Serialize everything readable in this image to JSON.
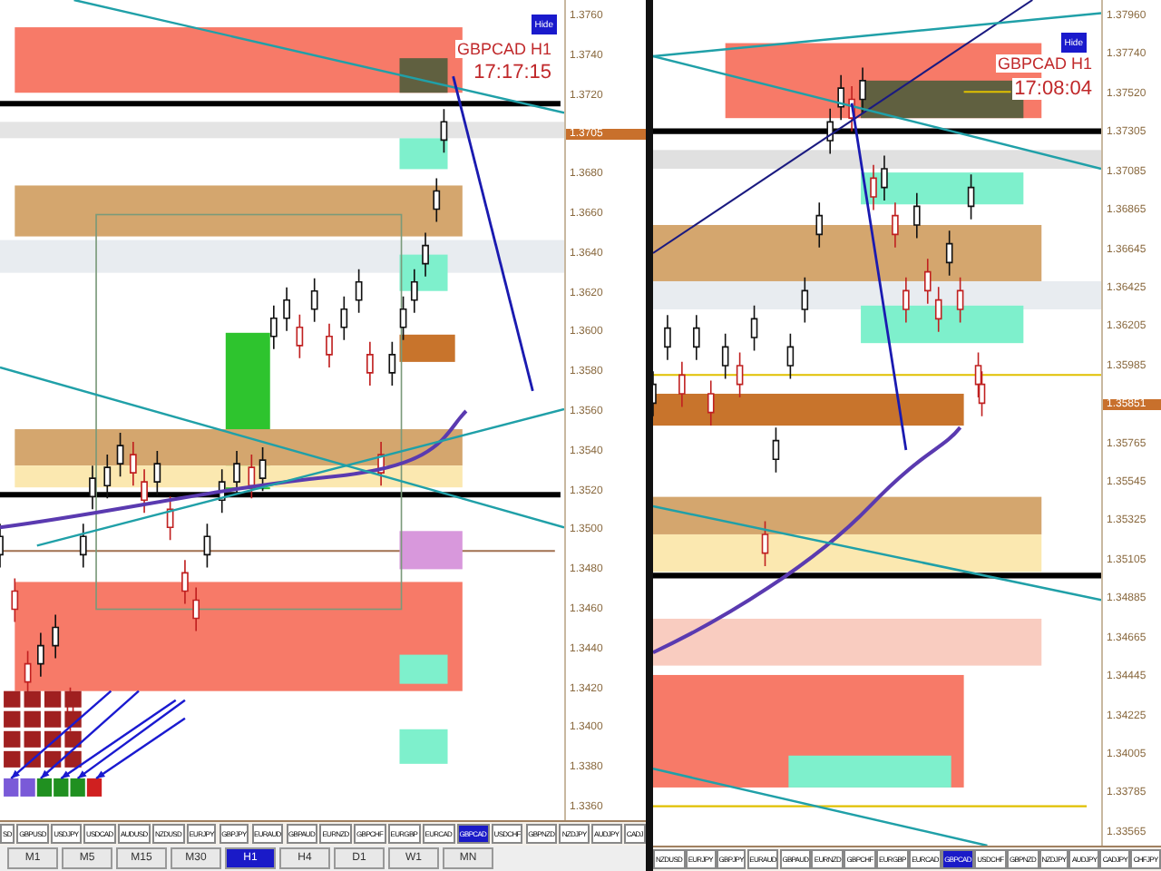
{
  "left_chart": {
    "title": "GBPCAD H1",
    "clock": "17:17:15",
    "hide_button": "Hide",
    "price_axis": [
      {
        "label": "1.3760",
        "current": false
      },
      {
        "label": "1.3740",
        "current": false
      },
      {
        "label": "1.3720",
        "current": false
      },
      {
        "label": "1.3705",
        "current": true
      },
      {
        "label": "1.3680",
        "current": false
      },
      {
        "label": "1.3660",
        "current": false
      },
      {
        "label": "1.3640",
        "current": false
      },
      {
        "label": "1.3620",
        "current": false
      },
      {
        "label": "1.3600",
        "current": false
      },
      {
        "label": "1.3580",
        "current": false
      },
      {
        "label": "1.3560",
        "current": false
      },
      {
        "label": "1.3540",
        "current": false
      },
      {
        "label": "1.3520",
        "current": false
      },
      {
        "label": "1.3500",
        "current": false
      },
      {
        "label": "1.3480",
        "current": false
      },
      {
        "label": "1.3460",
        "current": false
      },
      {
        "label": "1.3440",
        "current": false
      },
      {
        "label": "1.3420",
        "current": false
      },
      {
        "label": "1.3400",
        "current": false
      },
      {
        "label": "1.3380",
        "current": false
      },
      {
        "label": "1.3360",
        "current": false
      }
    ],
    "symbols": [
      {
        "label": "SD",
        "selected": false
      },
      {
        "label": "GBPUSD",
        "selected": false
      },
      {
        "label": "USDJPY",
        "selected": false
      },
      {
        "label": "USDCAD",
        "selected": false
      },
      {
        "label": "AUDUSD",
        "selected": false
      },
      {
        "label": "NZDUSD",
        "selected": false
      },
      {
        "label": "EURJPY",
        "selected": false
      },
      {
        "label": "GBPJPY",
        "selected": false
      },
      {
        "label": "EURAUD",
        "selected": false
      },
      {
        "label": "GBPAUD",
        "selected": false
      },
      {
        "label": "EURNZD",
        "selected": false
      },
      {
        "label": "GBPCHF",
        "selected": false
      },
      {
        "label": "EURGBP",
        "selected": false
      },
      {
        "label": "EURCAD",
        "selected": false
      },
      {
        "label": "GBPCAD",
        "selected": true
      },
      {
        "label": "USDCHF",
        "selected": false
      },
      {
        "label": "GBPNZD",
        "selected": false
      },
      {
        "label": "NZDJPY",
        "selected": false
      },
      {
        "label": "AUDJPY",
        "selected": false
      },
      {
        "label": "CADJ",
        "selected": false
      }
    ],
    "timeframes": [
      {
        "label": "M1",
        "selected": false
      },
      {
        "label": "M5",
        "selected": false
      },
      {
        "label": "M15",
        "selected": false
      },
      {
        "label": "M30",
        "selected": false
      },
      {
        "label": "H1",
        "selected": true
      },
      {
        "label": "H4",
        "selected": false
      },
      {
        "label": "D1",
        "selected": false
      },
      {
        "label": "W1",
        "selected": false
      },
      {
        "label": "MN",
        "selected": false
      }
    ]
  },
  "right_chart": {
    "title": "GBPCAD H1",
    "clock": "17:08:04",
    "hide_button": "Hide",
    "price_axis": [
      {
        "label": "1.37960",
        "current": false
      },
      {
        "label": "1.37740",
        "current": false
      },
      {
        "label": "1.37520",
        "current": false
      },
      {
        "label": "1.37305",
        "current": false
      },
      {
        "label": "1.37085",
        "current": false
      },
      {
        "label": "1.36865",
        "current": false
      },
      {
        "label": "1.36645",
        "current": false
      },
      {
        "label": "1.36425",
        "current": false
      },
      {
        "label": "1.36205",
        "current": false
      },
      {
        "label": "1.35985",
        "current": false
      },
      {
        "label": "1.35851",
        "current": true
      },
      {
        "label": "1.35765",
        "current": false
      },
      {
        "label": "1.35545",
        "current": false
      },
      {
        "label": "1.35325",
        "current": false
      },
      {
        "label": "1.35105",
        "current": false
      },
      {
        "label": "1.34885",
        "current": false
      },
      {
        "label": "1.34665",
        "current": false
      },
      {
        "label": "1.34445",
        "current": false
      },
      {
        "label": "1.34225",
        "current": false
      },
      {
        "label": "1.34005",
        "current": false
      },
      {
        "label": "1.33785",
        "current": false
      },
      {
        "label": "1.33565",
        "current": false
      }
    ],
    "symbols": [
      {
        "label": "NZDUSD",
        "selected": false
      },
      {
        "label": "EURJPY",
        "selected": false
      },
      {
        "label": "GBPJPY",
        "selected": false
      },
      {
        "label": "EURAUD",
        "selected": false
      },
      {
        "label": "GBPAUD",
        "selected": false
      },
      {
        "label": "EURNZD",
        "selected": false
      },
      {
        "label": "GBPCHF",
        "selected": false
      },
      {
        "label": "EURGBP",
        "selected": false
      },
      {
        "label": "EURCAD",
        "selected": false
      },
      {
        "label": "GBPCAD",
        "selected": true
      },
      {
        "label": "USDCHF",
        "selected": false
      },
      {
        "label": "GBPNZD",
        "selected": false
      },
      {
        "label": "NZDJPY",
        "selected": false
      },
      {
        "label": "AUDJPY",
        "selected": false
      },
      {
        "label": "CADJPY",
        "selected": false
      },
      {
        "label": "CHFJPY",
        "selected": false
      }
    ]
  }
}
